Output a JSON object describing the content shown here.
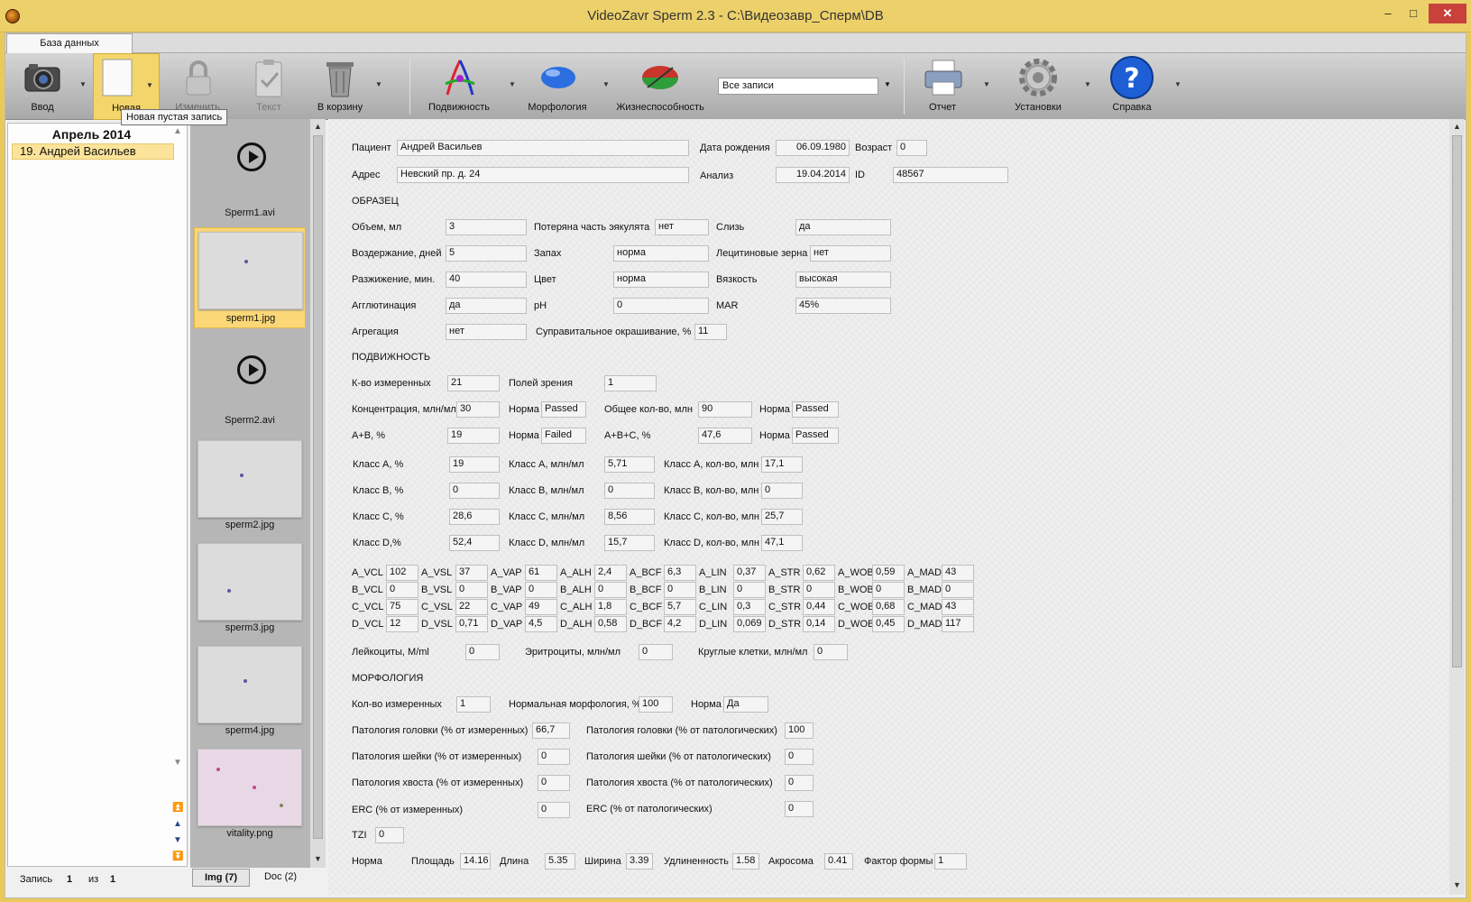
{
  "window": {
    "title": "VideoZavr Sperm 2.3 - C:\\Видеозавр_Сперм\\DB",
    "minimize": "–",
    "maximize": "□",
    "close": "✕"
  },
  "tabs": {
    "database": "База данных"
  },
  "toolbar": {
    "input": "Ввод",
    "new": "Новая",
    "edit": "Изменить",
    "text": "Текст",
    "trash": "В корзину",
    "motility": "Подвижность",
    "morphology": "Морфология",
    "vitality": "Жизнеспособность",
    "filter": "Все записи",
    "report": "Отчет",
    "settings": "Установки",
    "help": "Справка",
    "tooltip": "Новая пустая запись"
  },
  "records": {
    "month": "Апрель 2014",
    "items": [
      {
        "label": "19.  Андрей Васильев"
      }
    ]
  },
  "status": {
    "record_label": "Запись",
    "current": "1",
    "of_label": "из",
    "total": "1"
  },
  "thumbnails": [
    {
      "caption": "Sperm1.avi"
    },
    {
      "caption": "sperm1.jpg"
    },
    {
      "caption": "Sperm2.avi"
    },
    {
      "caption": "sperm2.jpg"
    },
    {
      "caption": "sperm3.jpg"
    },
    {
      "caption": "sperm4.jpg"
    },
    {
      "caption": "vitality.png"
    }
  ],
  "media_tabs": {
    "img": "Img (7)",
    "doc": "Doc (2)"
  },
  "patient": {
    "name_label": "Пациент",
    "name": "Андрей Васильев",
    "dob_label": "Дата рождения",
    "dob": "06.09.1980",
    "age_label": "Возраст",
    "age": "0",
    "address_label": "Адрес",
    "address": "Невский пр. д. 24",
    "analysis_label": "Анализ",
    "analysis_date": "19.04.2014",
    "id_label": "ID",
    "id": "48567"
  },
  "sample": {
    "title": "ОБРАЗЕЦ",
    "volume_label": "Объем, мл",
    "volume": "3",
    "lost_label": "Потеряна часть эякулята",
    "lost": "нет",
    "mucus_label": "Слизь",
    "mucus": "да",
    "abstinence_label": "Воздержание, дней",
    "abstinence": "5",
    "smell_label": "Запах",
    "smell": "норма",
    "lecithin_label": "Лецитиновые зерна",
    "lecithin": "нет",
    "liquefaction_label": "Разжижение, мин.",
    "liquefaction": "40",
    "color_label": "Цвет",
    "color": "норма",
    "viscosity_label": "Вязкость",
    "viscosity": "высокая",
    "agglutination_label": "Агглютинация",
    "agglutination": "да",
    "ph_label": "pH",
    "ph": "0",
    "mar_label": "MAR",
    "mar": "45%",
    "aggregation_label": "Агрегация",
    "aggregation": "нет",
    "supravital_label": "Суправитальное окрашивание, %",
    "supravital": "11"
  },
  "motility": {
    "title": "ПОДВИЖНОСТЬ",
    "measured_label": "К-во измеренных",
    "measured": "21",
    "fields_label": "Полей зрения",
    "fields": "1",
    "conc_label": "Концентрация, млн/мл",
    "conc": "30",
    "norm_label": "Норма",
    "conc_norm": "Passed",
    "total_label": "Общее кол-во, млн",
    "total": "90",
    "total_norm": "Passed",
    "ab_label": "A+B, %",
    "ab": "19",
    "ab_norm": "Failed",
    "abc_label": "A+B+C, %",
    "abc": "47,6",
    "abc_norm": "Passed",
    "classes": [
      {
        "pct_label": "Класс А, %",
        "pct": "19",
        "conc_label": "Класс А, млн/мл",
        "conc": "5,71",
        "cnt_label": "Класс А, кол-во, млн",
        "cnt": "17,1"
      },
      {
        "pct_label": "Класс В, %",
        "pct": "0",
        "conc_label": "Класс В, млн/мл",
        "conc": "0",
        "cnt_label": "Класс В, кол-во, млн",
        "cnt": "0"
      },
      {
        "pct_label": "Класс С, %",
        "pct": "28,6",
        "conc_label": "Класс С, млн/мл",
        "conc": "8,56",
        "cnt_label": "Класс С, кол-во, млн",
        "cnt": "25,7"
      },
      {
        "pct_label": "Класс D,%",
        "pct": "52,4",
        "conc_label": "Класс D, млн/мл",
        "conc": "15,7",
        "cnt_label": "Класс D, кол-во, млн",
        "cnt": "47,1"
      }
    ],
    "kinematics": [
      [
        [
          "A_VCL",
          "102"
        ],
        [
          "A_VSL",
          "37"
        ],
        [
          "A_VAP",
          "61"
        ],
        [
          "A_ALH",
          "2,4"
        ],
        [
          "A_BCF",
          "6,3"
        ],
        [
          "A_LIN",
          "0,37"
        ],
        [
          "A_STR",
          "0,62"
        ],
        [
          "A_WOB",
          "0,59"
        ],
        [
          "A_MAD",
          "43"
        ]
      ],
      [
        [
          "B_VCL",
          "0"
        ],
        [
          "B_VSL",
          "0"
        ],
        [
          "B_VAP",
          "0"
        ],
        [
          "B_ALH",
          "0"
        ],
        [
          "B_BCF",
          "0"
        ],
        [
          "B_LIN",
          "0"
        ],
        [
          "B_STR",
          "0"
        ],
        [
          "B_WOB",
          "0"
        ],
        [
          "B_MAD",
          "0"
        ]
      ],
      [
        [
          "C_VCL",
          "75"
        ],
        [
          "C_VSL",
          "22"
        ],
        [
          "C_VAP",
          "49"
        ],
        [
          "C_ALH",
          "1,8"
        ],
        [
          "C_BCF",
          "5,7"
        ],
        [
          "C_LIN",
          "0,3"
        ],
        [
          "C_STR",
          "0,44"
        ],
        [
          "C_WOB",
          "0,68"
        ],
        [
          "C_MAD",
          "43"
        ]
      ],
      [
        [
          "D_VCL",
          "12"
        ],
        [
          "D_VSL",
          "0,71"
        ],
        [
          "D_VAP",
          "4,5"
        ],
        [
          "D_ALH",
          "0,58"
        ],
        [
          "D_BCF",
          "4,2"
        ],
        [
          "D_LIN",
          "0,069"
        ],
        [
          "D_STR",
          "0,14"
        ],
        [
          "D_WOB",
          "0,45"
        ],
        [
          "D_MAD",
          "117"
        ]
      ]
    ],
    "leuko_label": "Лейкоциты, М/ml",
    "leuko": "0",
    "erythro_label": "Эритроциты, млн/мл",
    "erythro": "0",
    "round_label": "Круглые клетки, млн/мл",
    "round": "0"
  },
  "morphology": {
    "title": "МОРФОЛОГИЯ",
    "measured_label": "Кол-во измеренных",
    "measured": "1",
    "normal_label": "Нормальная морфология, %",
    "normal": "100",
    "norm_label": "Норма",
    "norm": "Да",
    "head_m_label": "Патология головки (% от измеренных)",
    "head_m": "66,7",
    "head_p_label": "Патология головки (% от патологических)",
    "head_p": "100",
    "neck_m_label": "Патология шейки (% от измеренных)",
    "neck_m": "0",
    "neck_p_label": "Патология шейки (% от патологических)",
    "neck_p": "0",
    "tail_m_label": "Патология хвоста (% от измеренных)",
    "tail_m": "0",
    "tail_p_label": "Патология хвоста (% от патологических)",
    "tail_p": "0",
    "erc_m_label": "ERC (% от измеренных)",
    "erc_m": "0",
    "erc_p_label": "ERC (% от патологических)",
    "erc_p": "0",
    "tzi_label": "TZI",
    "tzi": "0",
    "norm2_label": "Норма",
    "area_label": "Площадь",
    "area": "14.16",
    "length_label": "Длина",
    "length": "5.35",
    "width_label": "Ширина",
    "width": "3.39",
    "elong_label": "Удлиненность",
    "elong": "1.58",
    "acrosome_label": "Акросома",
    "acrosome": "0.41",
    "shape_label": "Фактор формы",
    "shape": "1"
  }
}
